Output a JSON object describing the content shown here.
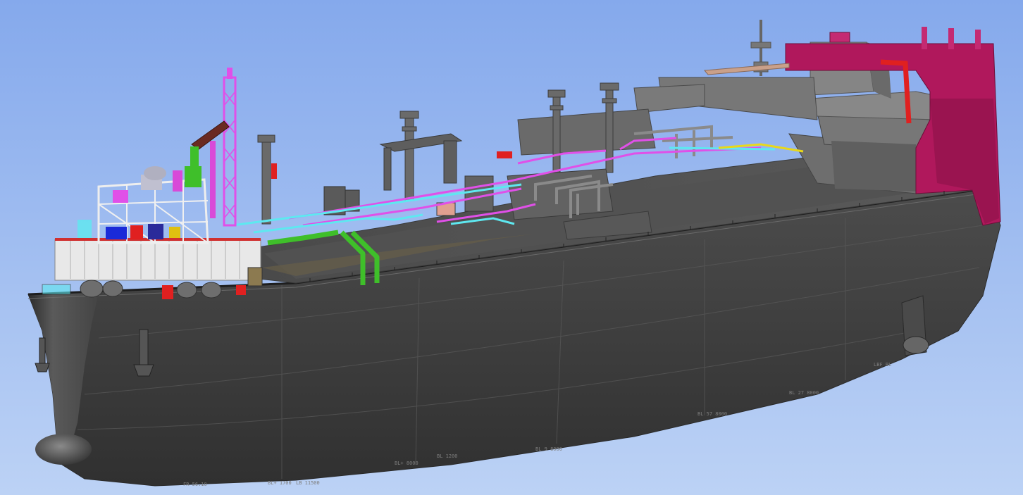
{
  "viewport": {
    "name": "3D ship model view",
    "background_top": "#85a9ec",
    "background_bottom": "#bcd2f5"
  },
  "colors": {
    "hull": "#4b4b4b",
    "hull_dark": "#333333",
    "hull_light": "#6d6d6d",
    "deck": "#575757",
    "superstructure": "#7b7b7b",
    "funnel_magenta": "#b0185c",
    "pipe_magenta": "#e050e8",
    "pipe_cyan": "#5ee8f0",
    "pipe_green": "#3fbf2a",
    "pipe_yellow": "#e8d81a",
    "equipment_red": "#e02020",
    "module_white": "#e8e8e8",
    "derrick_brown": "#6a2a22"
  },
  "hull_annotations": [
    "FR 56.10",
    "BL+ 1700",
    "LB 11500",
    "BL+ 8000",
    "BL 1200",
    "BL 9 8000",
    "BL 57 8000",
    "BL 27 8000",
    "LBF BL"
  ]
}
